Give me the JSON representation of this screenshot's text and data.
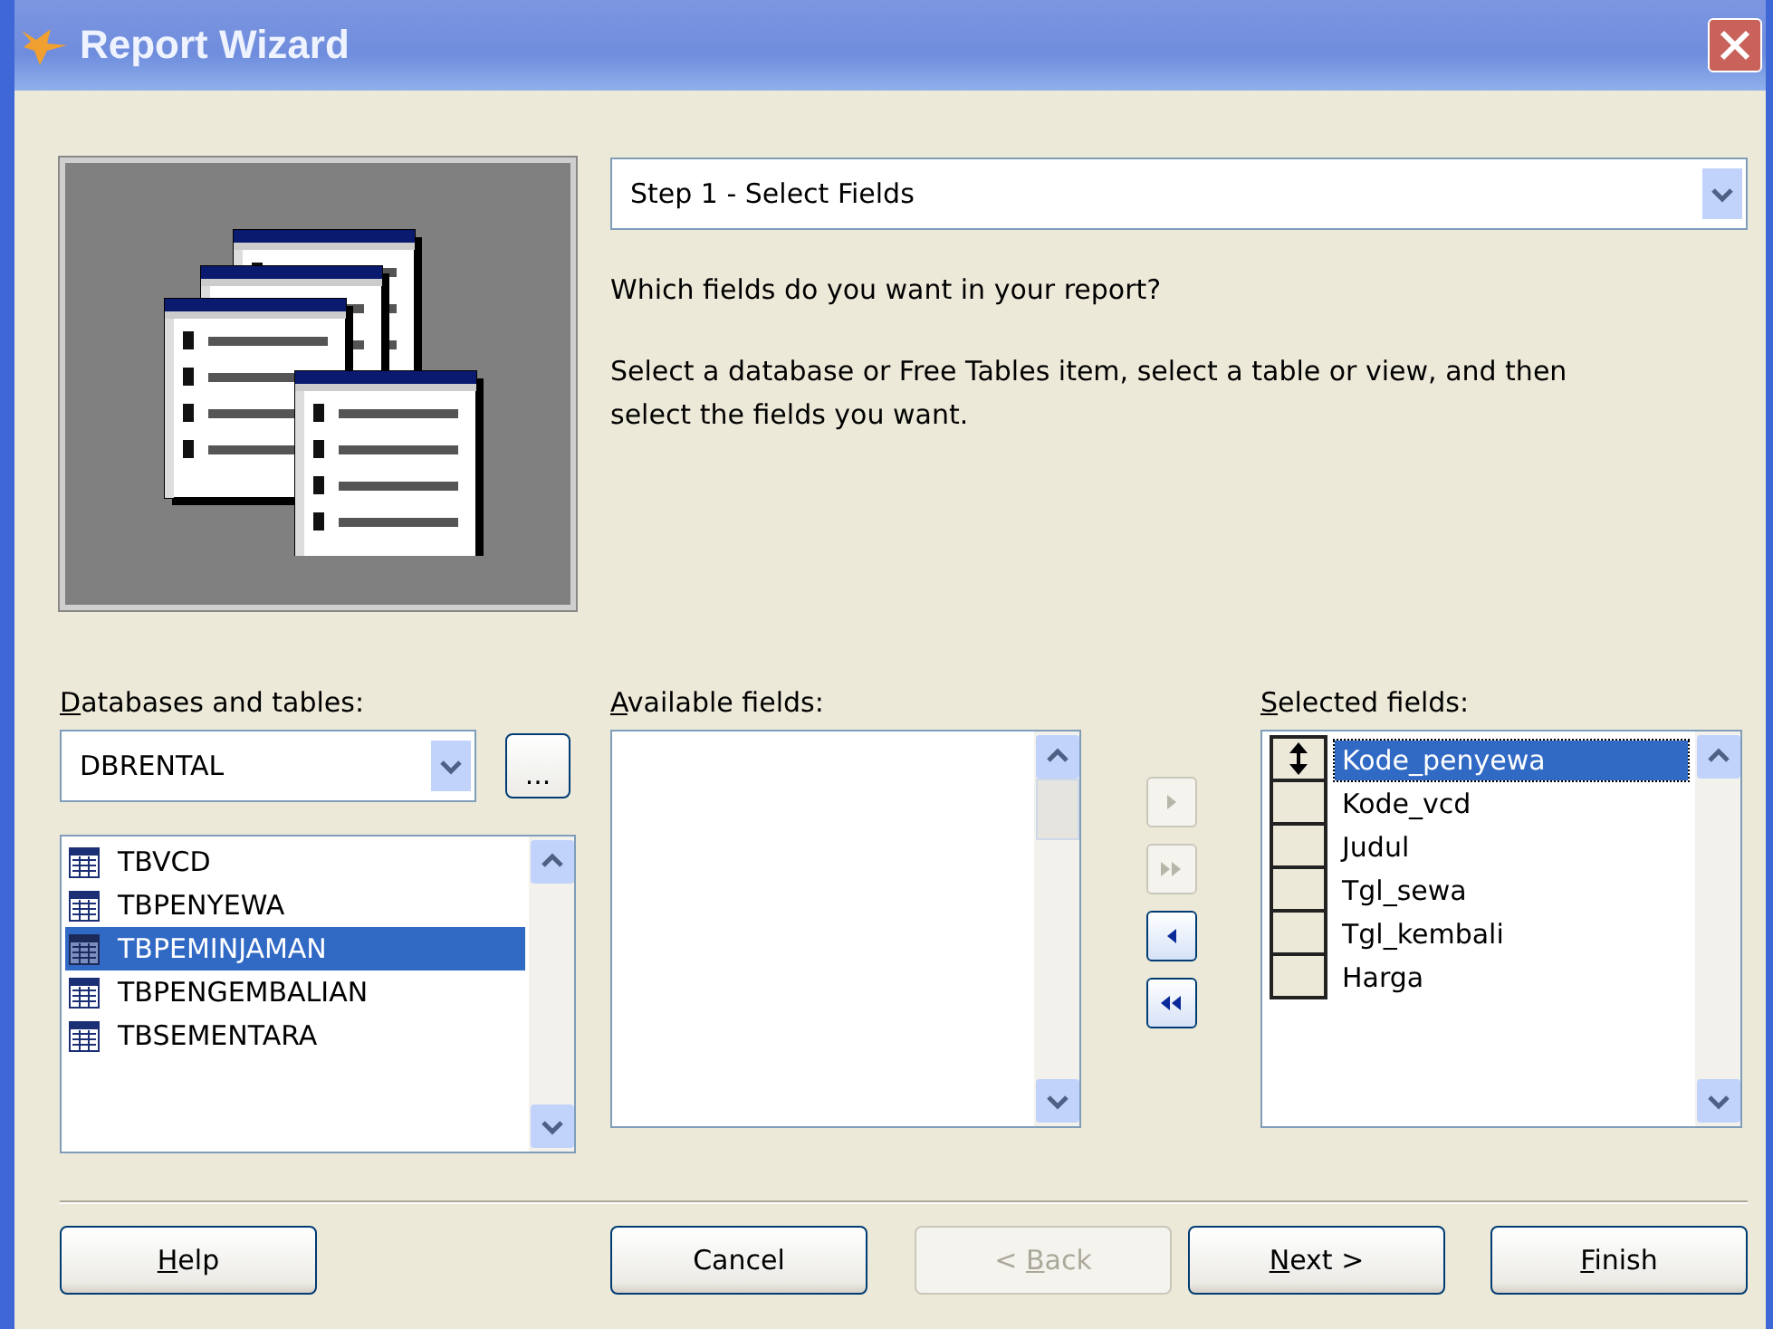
{
  "window": {
    "title": "Report Wizard"
  },
  "step": {
    "value": "Step 1 - Select Fields"
  },
  "question": "Which fields do you want in your report?",
  "instructions": "Select a database or Free Tables item, select a table or view, and then select the fields you want.",
  "databases": {
    "label": {
      "key": "D",
      "rest": "atabases and tables:"
    },
    "value": "DBRENTAL",
    "browse": "...",
    "tables": [
      {
        "name": "TBVCD",
        "selected": false
      },
      {
        "name": "TBPENYEWA",
        "selected": false
      },
      {
        "name": "TBPEMINJAMAN",
        "selected": true
      },
      {
        "name": "TBPENGEMBALIAN",
        "selected": false
      },
      {
        "name": "TBSEMENTARA",
        "selected": false
      }
    ]
  },
  "available": {
    "label": {
      "key": "A",
      "rest": "vailable fields:"
    }
  },
  "movers": [
    {
      "kind": "add",
      "disabled": true
    },
    {
      "kind": "add_all",
      "disabled": true
    },
    {
      "kind": "remove",
      "disabled": false
    },
    {
      "kind": "remove_all",
      "disabled": false
    }
  ],
  "selected_fields": {
    "label": {
      "key": "S",
      "rest": "elected fields:"
    },
    "items": [
      {
        "name": "Kode_penyewa",
        "selected": true
      },
      {
        "name": "Kode_vcd",
        "selected": false
      },
      {
        "name": "Judul",
        "selected": false
      },
      {
        "name": "Tgl_sewa",
        "selected": false
      },
      {
        "name": "Tgl_kembali",
        "selected": false
      },
      {
        "name": "Harga",
        "selected": false
      }
    ]
  },
  "buttons": [
    {
      "key": "H",
      "rest": "elp",
      "disabled": false
    },
    {
      "before": "Cancel",
      "disabled": false
    },
    {
      "before": "< ",
      "key": "B",
      "rest": "ack",
      "disabled": true
    },
    {
      "key": "N",
      "rest": "ext >",
      "disabled": false
    },
    {
      "key": "F",
      "rest": "inish",
      "disabled": false
    }
  ]
}
